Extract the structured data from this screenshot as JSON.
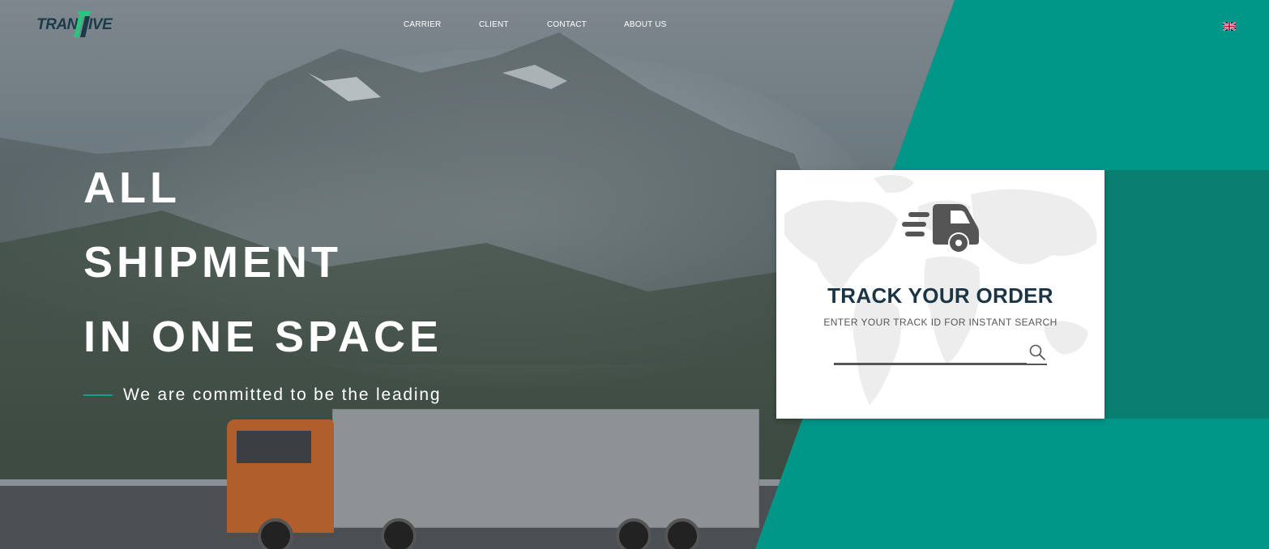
{
  "brand": {
    "logo_part1": "TRAN",
    "logo_part2": "IVE"
  },
  "nav": {
    "items": [
      {
        "label": "CARRIER"
      },
      {
        "label": "CLIENT"
      },
      {
        "label": "CONTACT"
      },
      {
        "label": "ABOUT US"
      }
    ]
  },
  "language": {
    "flag_icon": "uk-flag-icon"
  },
  "hero": {
    "headline": [
      "ALL",
      "SHIPMENT",
      "IN ONE SPACE"
    ],
    "tagline": "We are committed to be the leading"
  },
  "track": {
    "title": "TRACK YOUR ORDER",
    "subtitle": "ENTER YOUR TRACK ID FOR INSTANT SEARCH",
    "input_value": "",
    "icon": "truck-icon",
    "search_icon": "search-icon"
  },
  "colors": {
    "accent": "#009688",
    "accent_dark": "#087f71",
    "title": "#1b3545"
  }
}
